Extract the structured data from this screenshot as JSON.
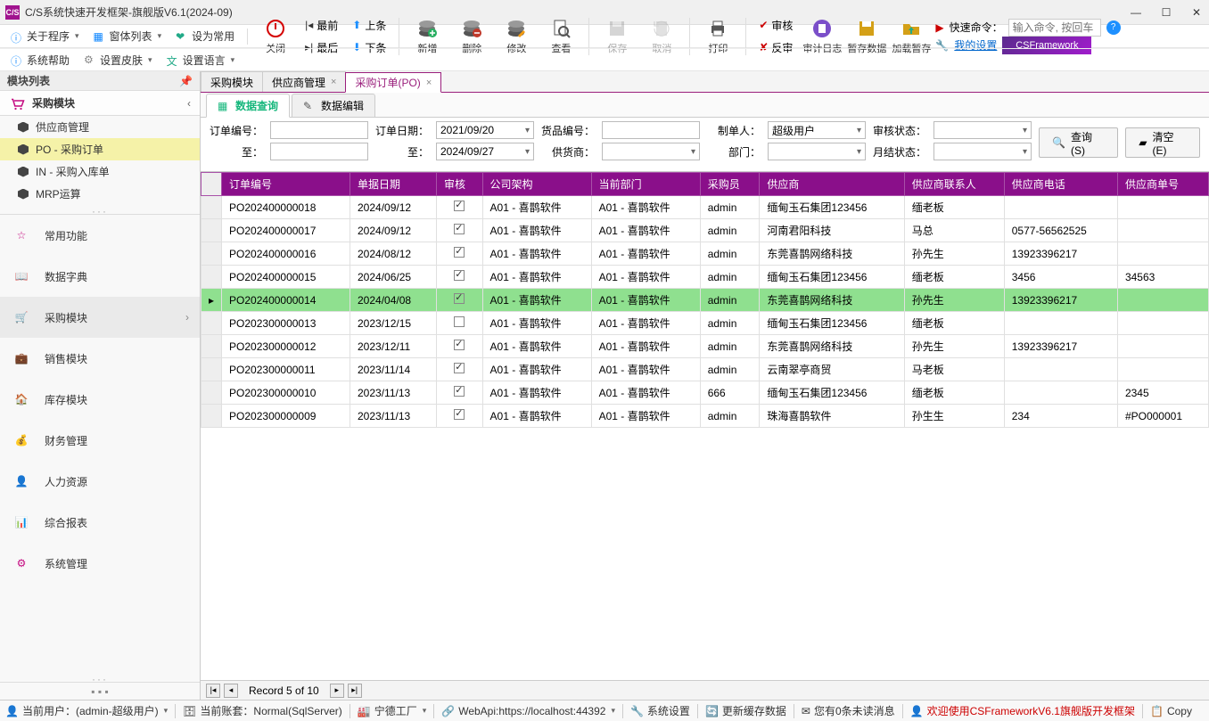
{
  "window": {
    "title": "C/S系统快速开发框架-旗舰版V6.1(2024-09)"
  },
  "menubar": {
    "about": "关于程序",
    "formlist": "窗体列表",
    "setcommon": "设为常用",
    "syshelp": "系统帮助",
    "setskin": "设置皮肤",
    "setlang": "设置语言"
  },
  "toolbar": {
    "close": "关闭",
    "first": "最前",
    "last": "最后",
    "prev": "上条",
    "next": "下条",
    "add": "新增",
    "del": "删除",
    "edit": "修改",
    "view": "查看",
    "save": "保存",
    "cancel": "取消",
    "print": "打印",
    "audit": "审核",
    "unaudit": "反审",
    "auditlog": "审计日志",
    "tempsave": "暂存数据",
    "loadtemp": "加载暂存",
    "quick_label": "快速命令：",
    "quick_placeholder": "输入命令, 按回车",
    "mysettings": "我的设置",
    "csfw": "CSFramework"
  },
  "sidebar": {
    "panel_title": "模块列表",
    "mod_title": "采购模块",
    "tree": [
      "供应商管理",
      "PO - 采购订单",
      "IN - 采购入库单",
      "MRP运算"
    ],
    "tree_sel": 1,
    "nav": [
      "常用功能",
      "数据字典",
      "采购模块",
      "销售模块",
      "库存模块",
      "财务管理",
      "人力资源",
      "综合报表",
      "系统管理"
    ],
    "nav_active": 2
  },
  "tabs": {
    "items": [
      {
        "label": "采购模块",
        "closable": false
      },
      {
        "label": "供应商管理",
        "closable": true
      },
      {
        "label": "采购订单(PO)",
        "closable": true
      }
    ],
    "active": 2
  },
  "subtabs": {
    "query": "数据查询",
    "edit": "数据编辑"
  },
  "filters": {
    "order_no": "订单编号：",
    "to": "至：",
    "order_date": "订单日期：",
    "date_from": "2021/09/20",
    "date_to": "2024/09/27",
    "goods_no": "货品编号：",
    "supplier": "供货商：",
    "maker": "制单人：",
    "maker_val": "超级用户",
    "dept": "部门：",
    "audit_status": "审核状态：",
    "month_status": "月结状态：",
    "btn_query": "查询(S)",
    "btn_clear": "清空(E)"
  },
  "grid": {
    "rowind": "",
    "cols": [
      "订单编号",
      "单据日期",
      "审核",
      "公司架构",
      "当前部门",
      "采购员",
      "供应商",
      "供应商联系人",
      "供应商电话",
      "供应商单号"
    ],
    "rows": [
      {
        "c": [
          "PO202400000018",
          "2024/09/12",
          true,
          "A01 - 喜鹊软件",
          "A01 - 喜鹊软件",
          "admin",
          "缅甸玉石集团123456",
          "缅老板",
          "",
          ""
        ]
      },
      {
        "c": [
          "PO202400000017",
          "2024/09/12",
          true,
          "A01 - 喜鹊软件",
          "A01 - 喜鹊软件",
          "admin",
          "河南君阳科技",
          "马总",
          "0577-56562525",
          ""
        ]
      },
      {
        "c": [
          "PO202400000016",
          "2024/08/12",
          true,
          "A01 - 喜鹊软件",
          "A01 - 喜鹊软件",
          "admin",
          "东莞喜鹊网络科技",
          "孙先生",
          "13923396217",
          ""
        ]
      },
      {
        "c": [
          "PO202400000015",
          "2024/06/25",
          true,
          "A01 - 喜鹊软件",
          "A01 - 喜鹊软件",
          "admin",
          "缅甸玉石集团123456",
          "缅老板",
          "3456",
          "34563"
        ]
      },
      {
        "c": [
          "PO202400000014",
          "2024/04/08",
          true,
          "A01 - 喜鹊软件",
          "A01 - 喜鹊软件",
          "admin",
          "东莞喜鹊网络科技",
          "孙先生",
          "13923396217",
          ""
        ],
        "hl": true
      },
      {
        "c": [
          "PO202300000013",
          "2023/12/15",
          false,
          "A01 - 喜鹊软件",
          "A01 - 喜鹊软件",
          "admin",
          "缅甸玉石集团123456",
          "缅老板",
          "",
          ""
        ]
      },
      {
        "c": [
          "PO202300000012",
          "2023/12/11",
          true,
          "A01 - 喜鹊软件",
          "A01 - 喜鹊软件",
          "admin",
          "东莞喜鹊网络科技",
          "孙先生",
          "13923396217",
          ""
        ]
      },
      {
        "c": [
          "PO202300000011",
          "2023/11/14",
          true,
          "A01 - 喜鹊软件",
          "A01 - 喜鹊软件",
          "admin",
          "云南翠亭商贸",
          "马老板",
          "",
          ""
        ]
      },
      {
        "c": [
          "PO202300000010",
          "2023/11/13",
          true,
          "A01 - 喜鹊软件",
          "A01 - 喜鹊软件",
          "666",
          "缅甸玉石集团123456",
          "缅老板",
          "",
          "2345"
        ]
      },
      {
        "c": [
          "PO202300000009",
          "2023/11/13",
          true,
          "A01 - 喜鹊软件",
          "A01 - 喜鹊软件",
          "admin",
          "珠海喜鹊软件",
          "孙生生",
          "234",
          "#PO000001"
        ]
      }
    ]
  },
  "pager": {
    "text": "Record 5 of 10"
  },
  "footer": {
    "user": "当前用户：(admin-超级用户)",
    "account": "当前账套：Normal(SqlServer)",
    "factory": "宁德工厂",
    "webapi": "WebApi:https://localhost:44392",
    "syssetting": "系统设置",
    "refreshcache": "更新缓存数据",
    "unread": "您有0条未读消息",
    "welcome": "欢迎使用CSFrameworkV6.1旗舰版开发框架",
    "copy": "Copy"
  }
}
